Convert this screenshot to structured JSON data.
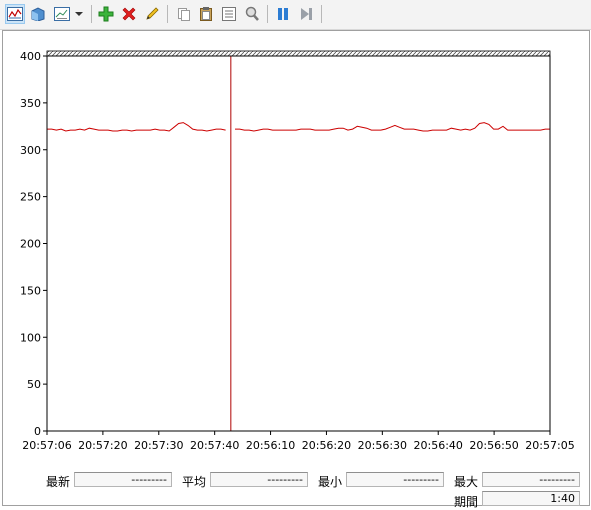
{
  "toolbar": {
    "buttons": [
      {
        "name": "view-graph-button",
        "icon": "graph-view-icon"
      },
      {
        "name": "view-histogram-button",
        "icon": "histogram-icon"
      },
      {
        "name": "view-report-button",
        "icon": "report-view-icon"
      },
      {
        "name": "change-graph-type-dropdown",
        "icon": "chevron-down-icon"
      },
      {
        "name": "add-counter-button",
        "icon": "plus-icon"
      },
      {
        "name": "delete-counter-button",
        "icon": "delete-x-icon"
      },
      {
        "name": "highlight-button",
        "icon": "pencil-icon"
      },
      {
        "name": "copy-properties-button",
        "icon": "copy-icon"
      },
      {
        "name": "paste-counters-button",
        "icon": "paste-icon"
      },
      {
        "name": "properties-button",
        "icon": "properties-icon"
      },
      {
        "name": "zoom-button",
        "icon": "magnifier-icon"
      },
      {
        "name": "freeze-display-button",
        "icon": "pause-icon"
      },
      {
        "name": "update-data-button",
        "icon": "step-forward-icon"
      }
    ]
  },
  "chart_data": {
    "type": "line",
    "title": "",
    "xlabel": "",
    "ylabel": "",
    "ylim": [
      0,
      400
    ],
    "yticks": [
      0,
      50,
      100,
      150,
      200,
      250,
      300,
      350,
      400
    ],
    "xtick_labels": [
      "20:57:06",
      "20:57:20",
      "20:57:30",
      "20:57:40",
      "20:56:10",
      "20:56:20",
      "20:56:30",
      "20:56:40",
      "20:56:50",
      "20:57:05"
    ],
    "grid": false,
    "legend": "none",
    "line_color": "#cc0000",
    "cursor_color": "#b00000",
    "series": [
      {
        "values": [
          322,
          322,
          321,
          322,
          320,
          321,
          321,
          322,
          321,
          323,
          322,
          321,
          321,
          321,
          320,
          320,
          321,
          321,
          320,
          321,
          321,
          321,
          321,
          322,
          321,
          321,
          320,
          324,
          328,
          329,
          326,
          322,
          321,
          321,
          320,
          321,
          322,
          322,
          321,
          321,
          322,
          322,
          321,
          321,
          320,
          321,
          322,
          322,
          321,
          321,
          321,
          321,
          321,
          321,
          322,
          322,
          322,
          321,
          321,
          321,
          321,
          322,
          323,
          323,
          321,
          322,
          325,
          324,
          323,
          321,
          321,
          321,
          322,
          324,
          326,
          324,
          322,
          322,
          322,
          321,
          320,
          320,
          321,
          321,
          321,
          321,
          323,
          322,
          321,
          322,
          321,
          323,
          328,
          329,
          327,
          322,
          322,
          325,
          321,
          321,
          321,
          321,
          321,
          321,
          321,
          321,
          322,
          322
        ]
      }
    ]
  },
  "stats": {
    "latest_label": "最新",
    "latest_value": "---------",
    "average_label": "平均",
    "average_value": "---------",
    "minimum_label": "最小",
    "minimum_value": "---------",
    "maximum_label": "最大",
    "maximum_value": "---------",
    "duration_label": "期間",
    "duration_value": "1:40"
  }
}
